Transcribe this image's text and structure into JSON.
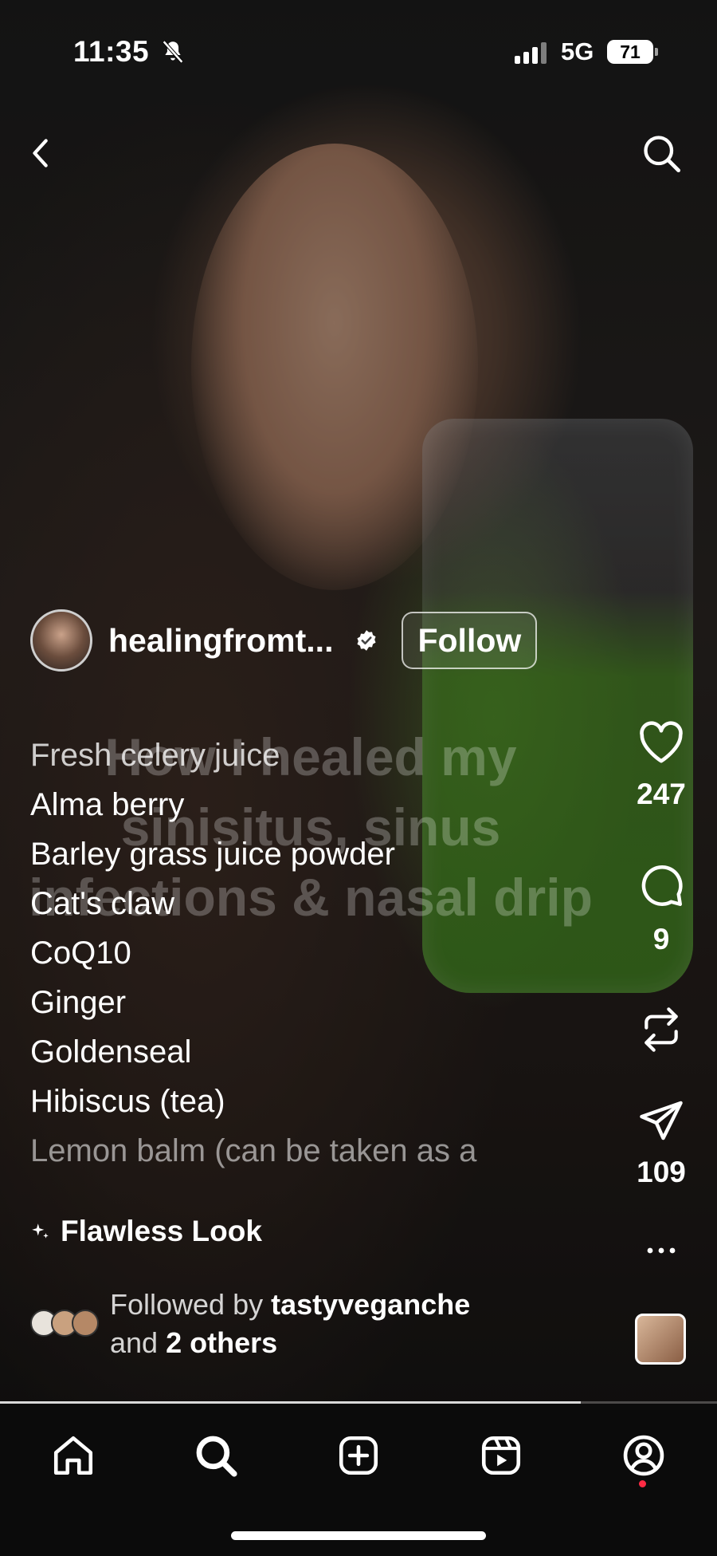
{
  "status": {
    "time": "11:35",
    "network": "5G",
    "battery": "71"
  },
  "post": {
    "username": "healingfromt...",
    "follow_label": "Follow",
    "overlay_text": "How I healed my sinisitus, sinus infections & nasal drip",
    "caption_lines": [
      "Fresh celery juice",
      "Alma berry",
      "Barley grass juice powder",
      "Cat's claw",
      "CoQ10",
      "Ginger",
      "Goldenseal",
      "Hibiscus (tea)",
      "Lemon balm (can be taken as a"
    ],
    "effect_label": "Flawless Look",
    "followed_prefix": "Followed by ",
    "followed_user": "tastyveganche",
    "followed_and": "and ",
    "followed_others": "2 others",
    "video_progress": 0.81
  },
  "actions": {
    "likes": "247",
    "comments": "9",
    "shares": "109"
  },
  "icons": {
    "back": "back-chevron-icon",
    "search": "search-icon",
    "like": "heart-icon",
    "comment": "comment-icon",
    "repost": "repost-icon",
    "share": "send-icon",
    "more": "more-dots-icon",
    "tabs": [
      "home-icon",
      "search-icon",
      "create-icon",
      "reels-icon",
      "profile-icon"
    ]
  },
  "colors": {
    "notification_dot": "#ff2b44",
    "juice_green": "#4f8a2a",
    "tabbar_bg": "#0b0b0b"
  }
}
